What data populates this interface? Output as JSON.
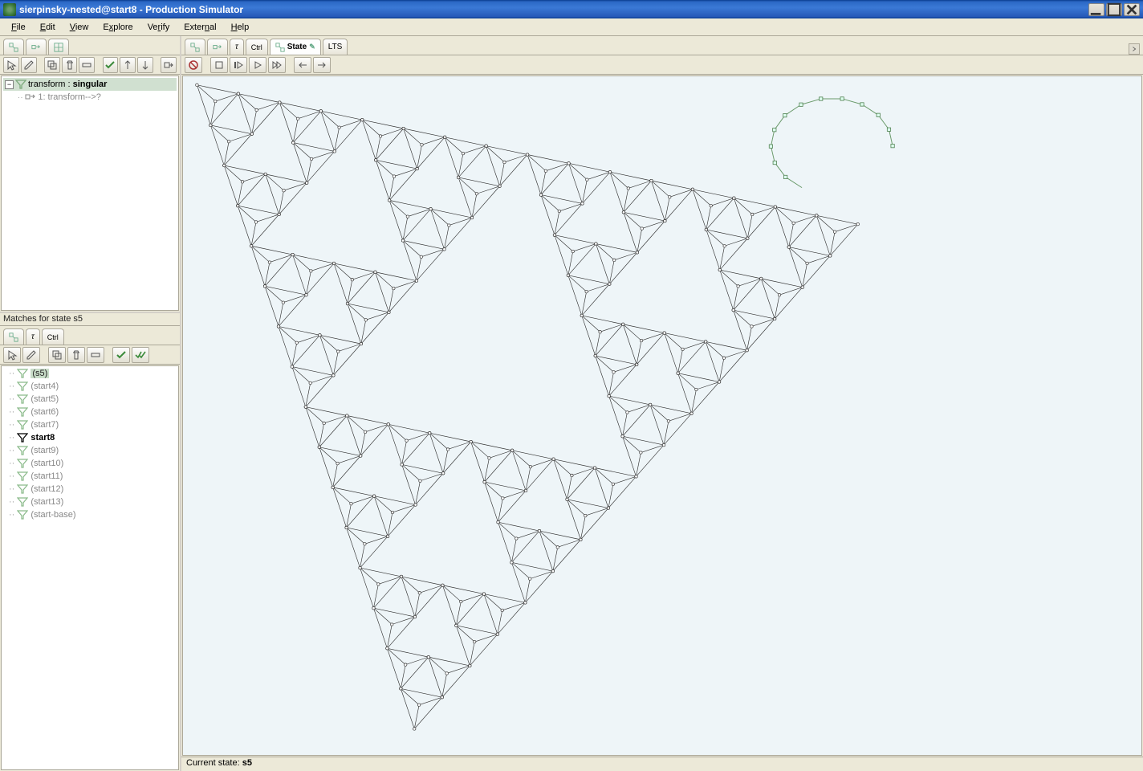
{
  "window": {
    "title": "sierpinsky-nested@start8 - Production Simulator"
  },
  "menu": {
    "file": "File",
    "edit": "Edit",
    "view": "View",
    "explore": "Explore",
    "verify": "Verify",
    "external": "External",
    "help": "Help"
  },
  "left_top": {
    "tabs": [
      "",
      "",
      ""
    ],
    "tree_root_prefix": "transform : ",
    "tree_root_bold": "singular",
    "tree_child": "1: transform-->?"
  },
  "mid_label": "Matches for state s5",
  "left_bottom": {
    "tabs": [
      "",
      "τ",
      "Ctrl"
    ],
    "states": [
      {
        "label": "(s5)",
        "selected": true
      },
      {
        "label": "(start4)"
      },
      {
        "label": "(start5)"
      },
      {
        "label": "(start6)"
      },
      {
        "label": "(start7)"
      },
      {
        "label": "start8",
        "current": true
      },
      {
        "label": "(start9)"
      },
      {
        "label": "(start10)"
      },
      {
        "label": "(start11)"
      },
      {
        "label": "(start12)"
      },
      {
        "label": "(start13)"
      },
      {
        "label": "(start-base)"
      }
    ]
  },
  "right": {
    "tabs": [
      {
        "label": ""
      },
      {
        "label": ""
      },
      {
        "label": "τ"
      },
      {
        "label": "Ctrl"
      },
      {
        "label": "State",
        "active": true,
        "pinned": true
      },
      {
        "label": "LTS"
      }
    ]
  },
  "status": {
    "prefix": "Current state: ",
    "value": "s5"
  }
}
